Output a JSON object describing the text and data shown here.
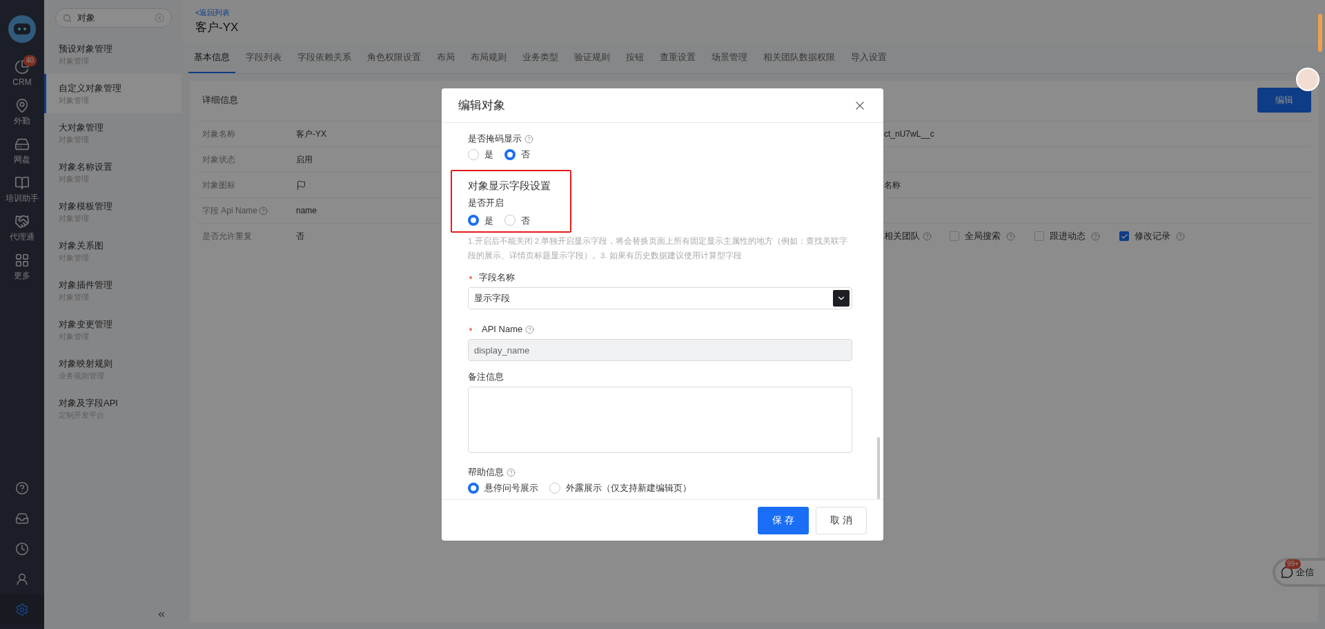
{
  "nav": {
    "items": [
      {
        "label": "CRM",
        "badge": "40"
      },
      {
        "label": "外勤"
      },
      {
        "label": "网盘"
      },
      {
        "label": "培训助手"
      },
      {
        "label": "代理通"
      },
      {
        "label": "更多"
      }
    ],
    "bottom": [
      {
        "selected": false
      },
      {
        "selected": false
      },
      {
        "selected": false
      },
      {
        "selected": false
      },
      {
        "selected": true
      }
    ]
  },
  "sidebar": {
    "search": {
      "value": "对象"
    },
    "items": [
      {
        "title": "预设对象管理",
        "subtitle": "对象管理",
        "selected": false
      },
      {
        "title": "自定义对象管理",
        "subtitle": "对象管理",
        "selected": true
      },
      {
        "title": "大对象管理",
        "subtitle": "对象管理",
        "selected": false
      },
      {
        "title": "对象名称设置",
        "subtitle": "对象管理",
        "selected": false
      },
      {
        "title": "对象模板管理",
        "subtitle": "对象管理",
        "selected": false
      },
      {
        "title": "对象关系图",
        "subtitle": "对象管理",
        "selected": false
      },
      {
        "title": "对象插件管理",
        "subtitle": "对象管理",
        "selected": false
      },
      {
        "title": "对象变更管理",
        "subtitle": "对象管理",
        "selected": false
      },
      {
        "title": "对象映射规则",
        "subtitle": "业务规则管理",
        "selected": false
      },
      {
        "title": "对象及字段API",
        "subtitle": "定制开发平台",
        "selected": false
      }
    ]
  },
  "header": {
    "back_link": "<返回列表",
    "title": "客户-YX"
  },
  "tabs": [
    {
      "label": "基本信息",
      "selected": true
    },
    {
      "label": "字段列表",
      "selected": false
    },
    {
      "label": "字段依赖关系",
      "selected": false
    },
    {
      "label": "角色权限设置",
      "selected": false
    },
    {
      "label": "布局",
      "selected": false
    },
    {
      "label": "布局规则",
      "selected": false
    },
    {
      "label": "业务类型",
      "selected": false
    },
    {
      "label": "验证规则",
      "selected": false
    },
    {
      "label": "按钮",
      "selected": false
    },
    {
      "label": "查重设置",
      "selected": false
    },
    {
      "label": "场景管理",
      "selected": false
    },
    {
      "label": "相关团队数据权限",
      "selected": false
    },
    {
      "label": "导入设置",
      "selected": false
    }
  ],
  "details": {
    "title": "详细信息",
    "edit_button": "编辑",
    "rows": [
      {
        "label": "对象名称",
        "help": false,
        "kind": "text",
        "value": "客户-YX",
        "right": "ct_nU7wL__c"
      },
      {
        "label": "对象状态",
        "help": false,
        "kind": "text",
        "value": "启用"
      },
      {
        "label": "对象图标",
        "help": false,
        "kind": "icon",
        "right": "名称"
      },
      {
        "label": "字段 Api Name",
        "help": true,
        "kind": "text",
        "value": "name"
      },
      {
        "label": "是否允许重复",
        "help": false,
        "kind": "text",
        "value": "否",
        "team_label": "相关团队",
        "checkboxes": [
          {
            "label": "全局搜索",
            "checked": false
          },
          {
            "label": "跟进动态",
            "checked": false
          },
          {
            "label": "修改记录",
            "checked": true
          }
        ]
      }
    ]
  },
  "dialog": {
    "title": "编辑对象",
    "sections": [
      {
        "kind": "radio",
        "label": "是否掩码显示",
        "help": true,
        "options": [
          {
            "label": "是",
            "selected": false
          },
          {
            "label": "否",
            "selected": true
          }
        ]
      },
      {
        "kind": "highlight_group",
        "title": "对象显示字段设置",
        "label": "是否开启",
        "options": [
          {
            "label": "是",
            "selected": true
          },
          {
            "label": "否",
            "selected": false
          }
        ]
      },
      {
        "kind": "note",
        "text": "1.开启后不能关闭 2.单独开启显示字段，将会替换页面上所有固定显示主属性的地方（例如：查找关联字段的展示、详情页标题显示字段）。3. 如果有历史数据建议使用计算型字段"
      },
      {
        "kind": "select",
        "label": "字段名称",
        "required": true,
        "value": "显示字段"
      },
      {
        "kind": "input",
        "label": "API Name",
        "required": true,
        "help": true,
        "disabled": true,
        "value": "display_name"
      },
      {
        "kind": "textarea",
        "label": "备注信息"
      },
      {
        "kind": "radio",
        "label": "帮助信息",
        "help": true,
        "with_input": true,
        "options": [
          {
            "label": "悬停问号展示",
            "selected": true
          },
          {
            "label": "外露展示（仅支持新建编辑页）",
            "selected": false
          }
        ]
      }
    ],
    "buttons": [
      {
        "label": "保 存",
        "primary": true
      },
      {
        "label": "取 消",
        "primary": false
      }
    ]
  },
  "chat": {
    "label": "企信",
    "badge": "99+"
  }
}
